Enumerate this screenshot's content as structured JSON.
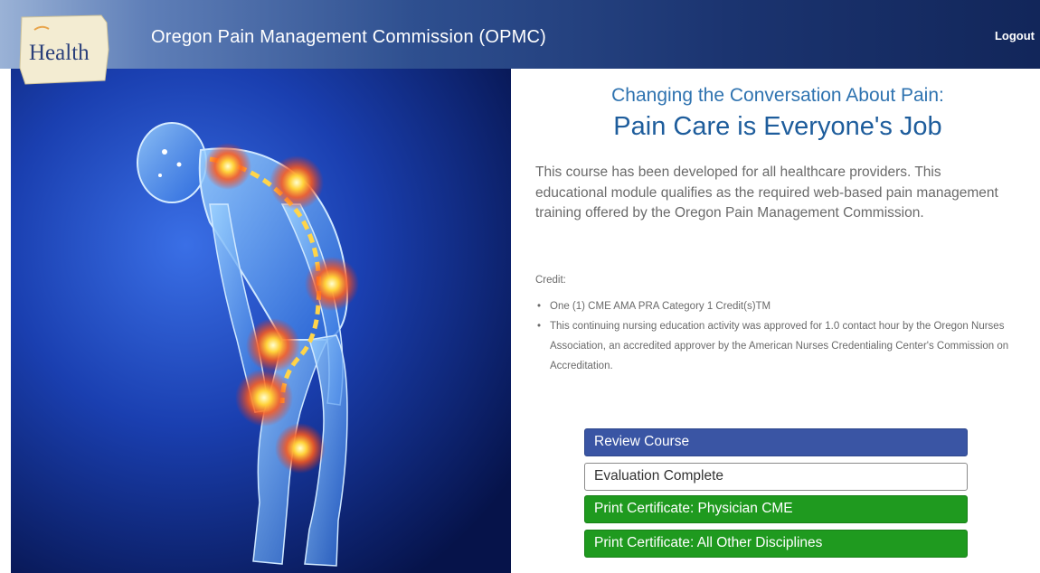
{
  "header": {
    "logo_text": "Health",
    "title": "Oregon Pain Management Commission (OPMC)",
    "logout_label": "Logout"
  },
  "main": {
    "subtitle": "Changing the Conversation About Pain:",
    "title": "Pain Care is Everyone's Job",
    "description": "This course has been developed for all healthcare providers. This educational module qualifies as the required web-based pain management training offered by the Oregon Pain Management Commission.",
    "credit_label": "Credit:",
    "credits": [
      "One (1) CME AMA PRA Category 1 Credit(s)TM",
      "This continuing nursing education activity was approved for 1.0 contact hour by the Oregon Nurses Association, an accredited approver by the American Nurses Credentialing Center's Commission on Accreditation."
    ],
    "buttons": {
      "review": "Review Course",
      "evaluation": "Evaluation Complete",
      "physician_cert": "Print Certificate: Physician CME",
      "other_cert": "Print Certificate: All Other Disciplines"
    }
  },
  "colors": {
    "header_dark": "#12265a",
    "title_blue": "#1e5d9c",
    "review_button": "#3a55a4",
    "certificate_button": "#1f9a1f"
  }
}
